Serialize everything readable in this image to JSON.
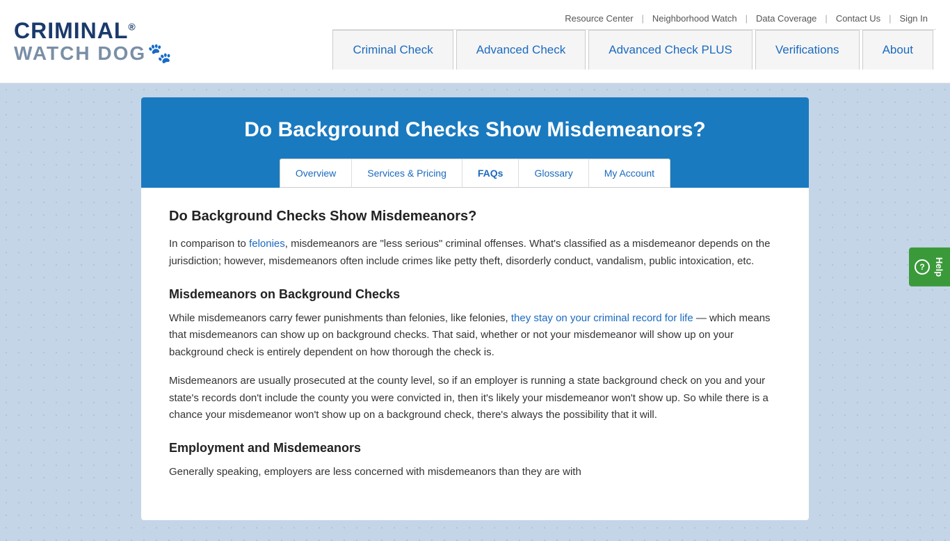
{
  "logo": {
    "criminal": "CRIMINAL",
    "watchdog": "WATCH DOG",
    "trademark": "®"
  },
  "secondary_nav": {
    "items": [
      {
        "label": "Resource Center",
        "href": "#"
      },
      {
        "label": "Neighborhood Watch",
        "href": "#"
      },
      {
        "label": "Data Coverage",
        "href": "#"
      },
      {
        "label": "Contact Us",
        "href": "#"
      },
      {
        "label": "Sign In",
        "href": "#"
      }
    ]
  },
  "main_nav": {
    "items": [
      {
        "label": "Criminal Check",
        "href": "#"
      },
      {
        "label": "Advanced Check",
        "href": "#"
      },
      {
        "label": "Advanced Check PLUS",
        "href": "#"
      },
      {
        "label": "Verifications",
        "href": "#"
      },
      {
        "label": "About",
        "href": "#"
      }
    ]
  },
  "hero": {
    "title": "Do Background Checks Show Misdemeanors?"
  },
  "sub_nav": {
    "items": [
      {
        "label": "Overview",
        "active": false
      },
      {
        "label": "Services & Pricing",
        "active": false
      },
      {
        "label": "FAQs",
        "active": true
      },
      {
        "label": "Glossary",
        "active": false
      },
      {
        "label": "My Account",
        "active": false
      }
    ]
  },
  "content": {
    "main_heading": "Do Background Checks Show Misdemeanors?",
    "intro": "In comparison to ",
    "felonies_link": "felonies",
    "intro_rest": ", misdemeanors are \"less serious\" criminal offenses. What's classified as a misdemeanor depends on the jurisdiction; however, misdemeanors often include crimes like petty theft, disorderly conduct, vandalism, public intoxication, etc.",
    "section1_heading": "Misdemeanors on Background Checks",
    "section1_para1_start": "While misdemeanors carry fewer punishments than felonies, like felonies, ",
    "section1_link": "they stay on your criminal record for life",
    "section1_para1_end": " — which means that misdemeanors can show up on background checks. That said, whether or not your misdemeanor will show up on your background check is entirely dependent on how thorough the check is.",
    "section1_para2": "Misdemeanors are usually prosecuted at the county level, so if an employer is running a state background check on you and your state's records don't include the county you were convicted in, then it's likely your misdemeanor won't show up. So while there is a chance your misdemeanor won't show up on a background check, there's always the possibility that it will.",
    "section2_heading": "Employment and Misdemeanors",
    "section2_para1_start": "Generally speaking, employers are less concerned with misdemeanors than they are with"
  },
  "help_button": {
    "label": "Help"
  }
}
